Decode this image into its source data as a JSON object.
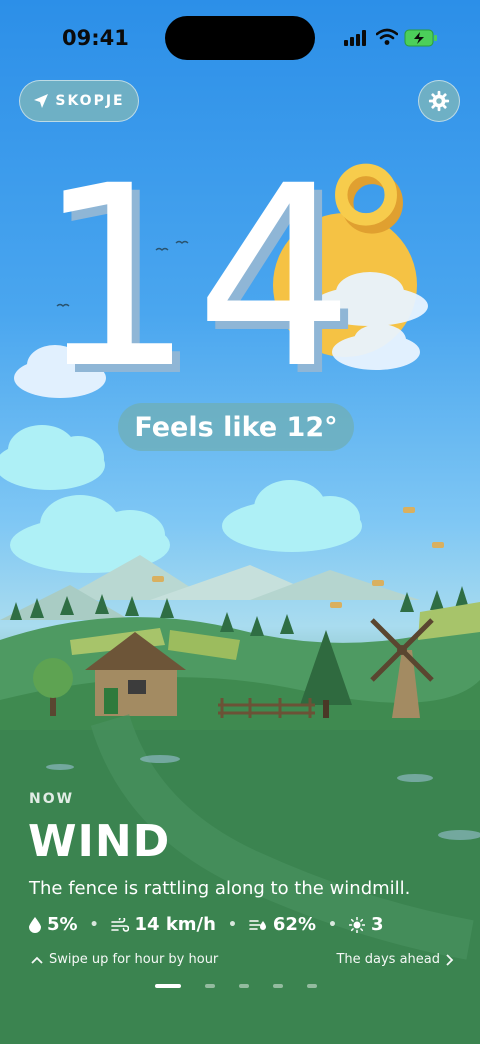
{
  "status_bar": {
    "time": "09:41"
  },
  "location": {
    "label": "SKOPJE"
  },
  "weather": {
    "temperature": "14",
    "degree": "°",
    "feels_like": "Feels like 12°",
    "now_label": "NOW",
    "condition": "WIND",
    "description": "The fence is rattling along to the windmill."
  },
  "stats": {
    "precipitation": "5%",
    "wind": "14 km/h",
    "humidity": "62%",
    "uv": "3"
  },
  "footer": {
    "hourly_hint": "Swipe up for hour by hour",
    "days_link": "The days ahead"
  },
  "pager": {
    "count": 5,
    "active": 0
  },
  "colors": {
    "sky_top": "#2c8fe8",
    "grass": "#3f8a50",
    "sun": "#f5c244"
  },
  "icons": [
    "location-arrow-icon",
    "gear-icon",
    "drop-icon",
    "wind-icon",
    "humidity-icon",
    "sun-icon",
    "chevron-up-icon",
    "chevron-right-icon"
  ]
}
